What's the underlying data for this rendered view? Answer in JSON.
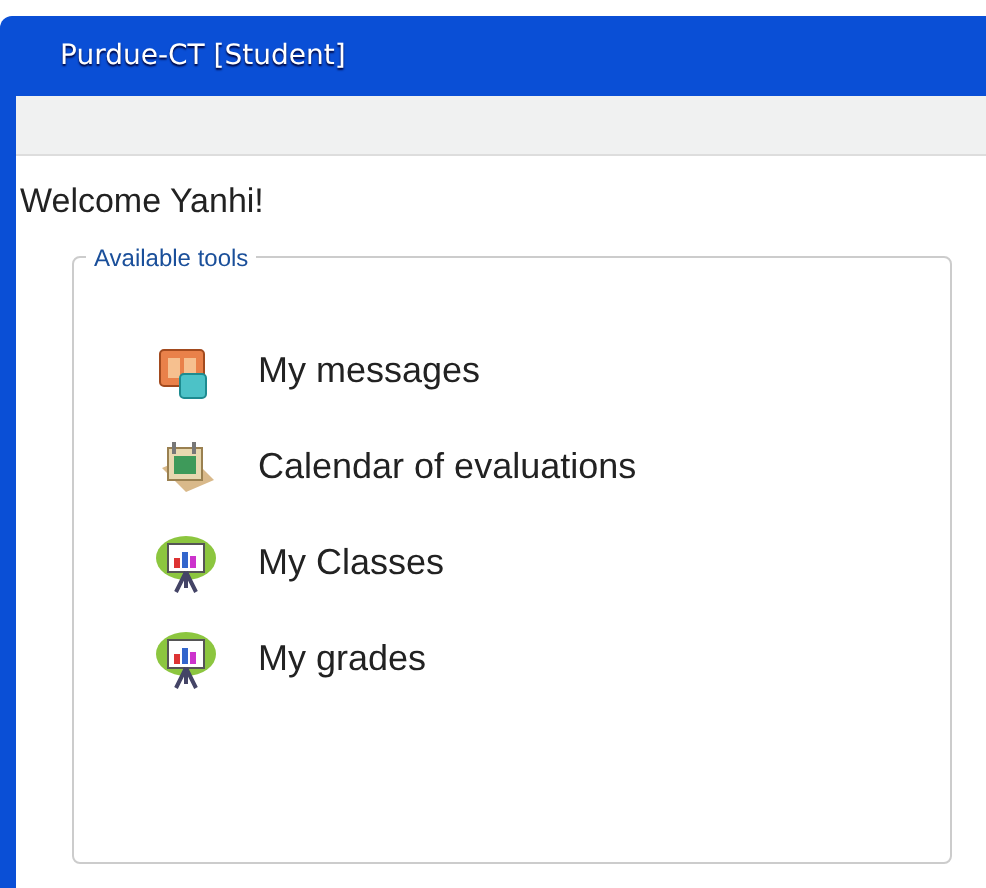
{
  "window": {
    "title": "Purdue-CT [Student]"
  },
  "welcome": "Welcome Yanhi!",
  "tools_panel": {
    "legend": "Available tools",
    "items": [
      {
        "label": "My messages",
        "kind": "messages"
      },
      {
        "label": "Calendar of evaluations",
        "kind": "calendar"
      },
      {
        "label": "My Classes",
        "kind": "presentation"
      },
      {
        "label": "My grades",
        "kind": "presentation"
      }
    ]
  }
}
